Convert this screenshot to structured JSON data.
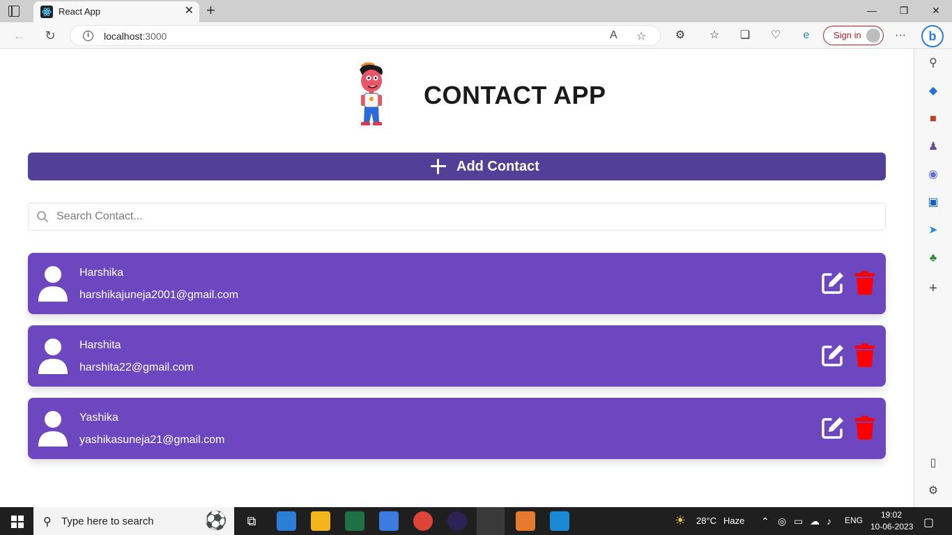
{
  "browser": {
    "tab_title": "React App",
    "url_host": "localhost",
    "url_port": ":3000",
    "signin_label": "Sign in",
    "bing_label": "b"
  },
  "app": {
    "title": "CONTACT APP",
    "add_button_label": "Add Contact",
    "search_placeholder": "Search Contact...",
    "contacts": [
      {
        "name": "Harshika",
        "email": "harshikajuneja2001@gmail.com"
      },
      {
        "name": "Harshita",
        "email": "harshita22@gmail.com"
      },
      {
        "name": "Yashika",
        "email": "yashikasuneja21@gmail.com"
      }
    ]
  },
  "colors": {
    "add_button": "#523f98",
    "contact_card": "#6c47c0",
    "delete_icon": "#ff0000"
  },
  "taskbar": {
    "search_placeholder": "Type here to search",
    "weather_temp": "28°C",
    "weather_desc": "Haze",
    "language": "ENG",
    "time": "19:02",
    "date": "10-06-2023"
  }
}
